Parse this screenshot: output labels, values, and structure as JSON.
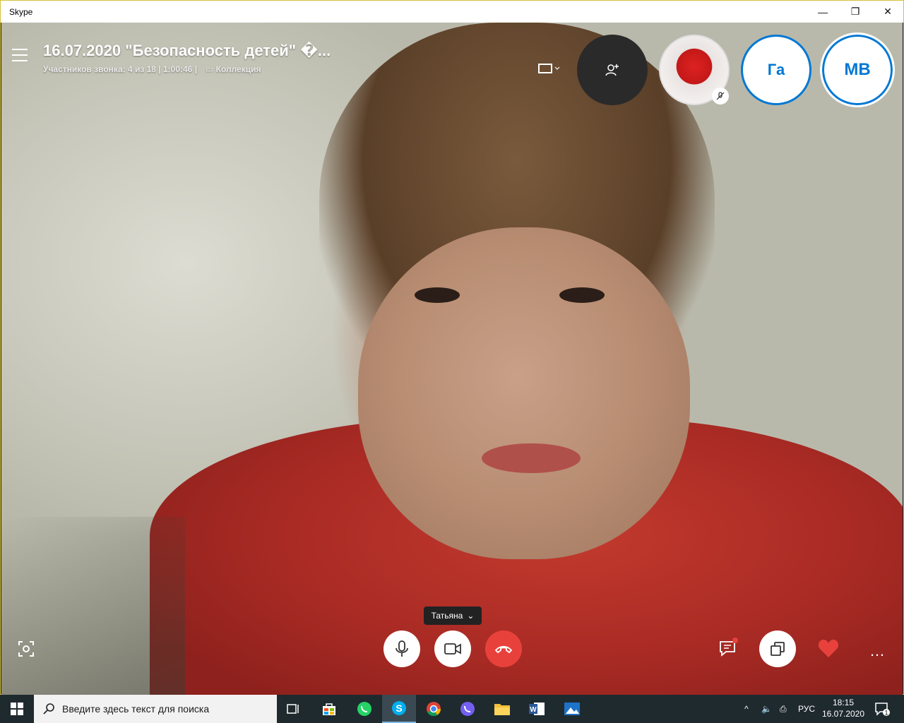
{
  "window": {
    "title": "Skype",
    "minimize": "—",
    "maximize": "❐",
    "close": "✕"
  },
  "call": {
    "title": "16.07.2020 \"Безопасность детей\" �...",
    "participants_info": "Участников звонка: 4 из 18 | 1:00:46  |",
    "collection": "Коллекция",
    "speaker": "Татьяна"
  },
  "participants": [
    {
      "initials": "",
      "icon": "photo-avatar",
      "muted": true
    },
    {
      "initials": "Га",
      "icon": "",
      "muted": false
    },
    {
      "initials": "MB",
      "icon": "",
      "muted": false
    }
  ],
  "controls": {
    "mic": "microphone-icon",
    "camera": "video-camera-icon",
    "end": "hang-up-icon",
    "chat": "chat-icon",
    "share": "share-screen-icon",
    "react": "heart-icon",
    "more": "…"
  },
  "taskbar": {
    "search_placeholder": "Введите здесь текст для поиска",
    "language": "РУС",
    "time": "18:15",
    "date": "16.07.2020",
    "notification_count": "1"
  },
  "colors": {
    "accent": "#0078d4",
    "end_call": "#e8413b",
    "taskbar": "#1f2a2f",
    "border": "#e8d84a"
  }
}
